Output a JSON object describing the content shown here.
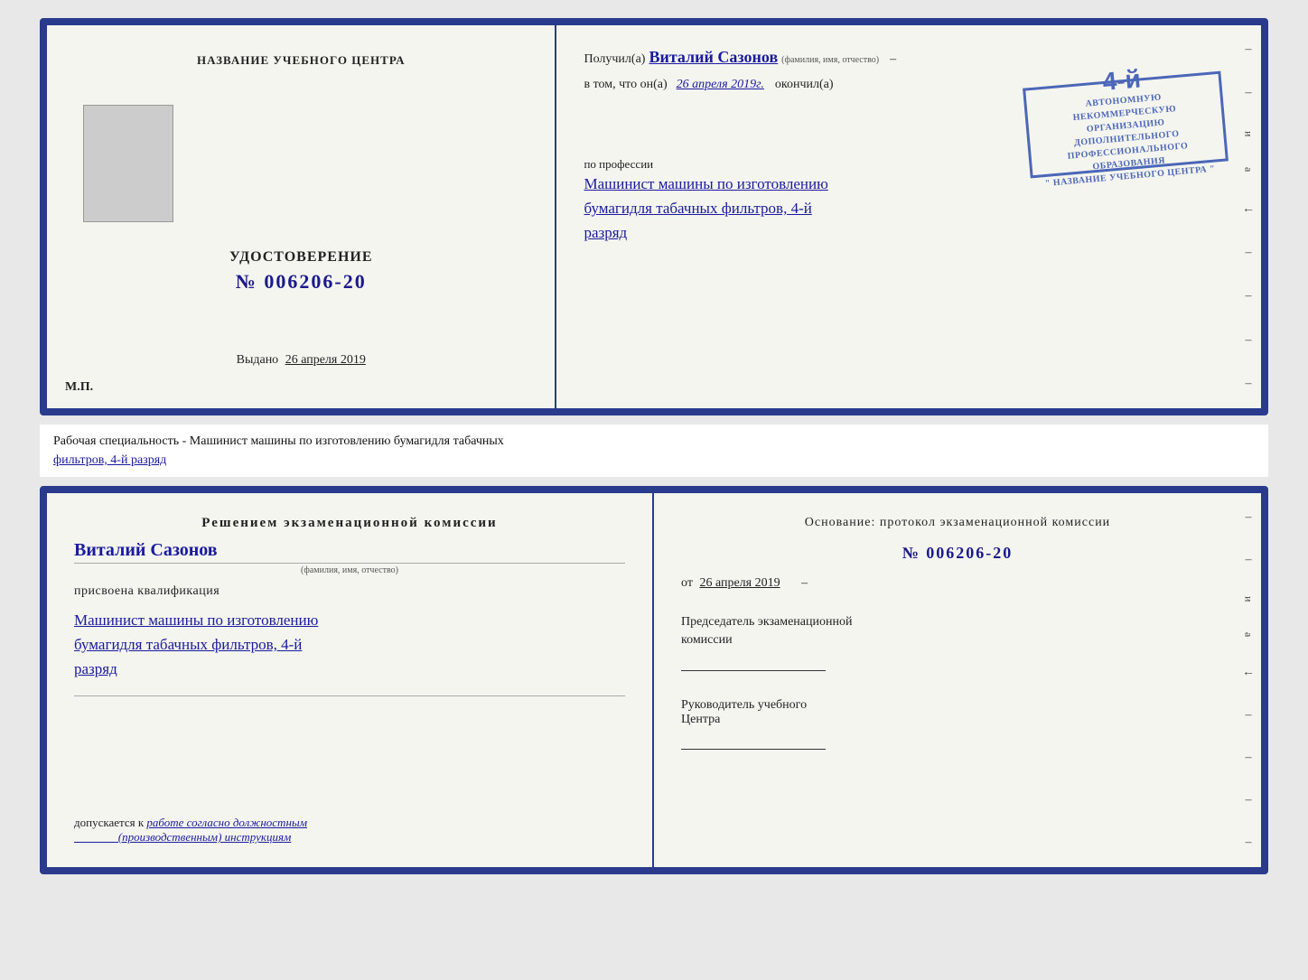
{
  "top_cert": {
    "left": {
      "center_title": "НАЗВАНИЕ УЧЕБНОГО ЦЕНТРА",
      "cert_label": "УДОСТОВЕРЕНИЕ",
      "cert_number": "№ 006206-20",
      "issued_prefix": "Выдано",
      "issued_date": "26 апреля 2019",
      "mp_label": "М.П."
    },
    "right": {
      "received_prefix": "Получил(а)",
      "recipient_name": "Виталий Сазонов",
      "fio_sub": "(фамилия, имя, отчество)",
      "in_that_prefix": "в том, что он(а)",
      "completion_date": "26 апреля 2019г.",
      "finished_label": "окончил(а)",
      "stamp_number": "4-й",
      "stamp_line1": "АВТОНОМНУЮ НЕКОММЕРЧЕСКУЮ ОРГАНИЗАЦИЮ",
      "stamp_line2": "ДОПОЛНИТЕЛЬНОГО ПРОФЕССИОНАЛЬНОГО ОБРАЗОВАНИЯ",
      "stamp_line3": "\" НАЗВАНИЕ УЧЕБНОГО ЦЕНТРА \"",
      "profession_label": "по профессии",
      "profession_text": "Машинист машины по изготовлению\nбумагидля табачных фильтров, 4-й\nразряд"
    }
  },
  "middle_section": {
    "text": "Рабочая специальность - Машинист машины по изготовлению бумагидля табачных",
    "text2": "фильтров, 4-й разряд"
  },
  "bottom_cert": {
    "left": {
      "title": "Решением экзаменационной комиссии",
      "person_name": "Виталий Сазонов",
      "fio_sub": "(фамилия, имя, отчество)",
      "qualification_label": "присвоена квалификация",
      "qualification_text": "Машинист машины по изготовлению\nбумагидля табачных фильтров, 4-й\nразряд",
      "allowed_prefix": "допускается к",
      "allowed_text": "работе согласно должностным\n(производственным) инструкциям"
    },
    "right": {
      "basis_label": "Основание: протокол экзаменационной комиссии",
      "protocol_number": "№ 006206-20",
      "from_prefix": "от",
      "from_date": "26 апреля 2019",
      "commission_head_label": "Председатель экзаменационной\nкомиссии",
      "center_head_label": "Руководитель учебного\nЦентра"
    }
  },
  "colors": {
    "border": "#2a3a8c",
    "handwritten": "#1a1a9e",
    "stamp": "#2244aa",
    "text": "#222222"
  }
}
